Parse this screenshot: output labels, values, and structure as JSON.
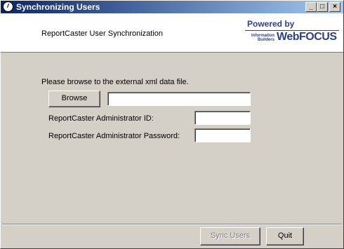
{
  "window": {
    "title": "Synchronizing Users",
    "controls": {
      "minimize": "_",
      "maximize": "□",
      "close": "×"
    }
  },
  "header": {
    "title": "ReportCaster User Synchronization",
    "logo": {
      "powered_by": "Powered by",
      "information_builders": "Information Builders",
      "webfocus": "WebFOCUS"
    }
  },
  "form": {
    "prompt": "Please browse to the external xml data file.",
    "browse_label": "Browse",
    "file_value": "",
    "admin_id_label": "ReportCaster Administrator ID:",
    "admin_id_value": "",
    "admin_password_label": "ReportCaster Administrator Password:",
    "admin_password_value": ""
  },
  "footer": {
    "sync_label": "Sync Users",
    "sync_enabled": false,
    "quit_label": "Quit"
  }
}
